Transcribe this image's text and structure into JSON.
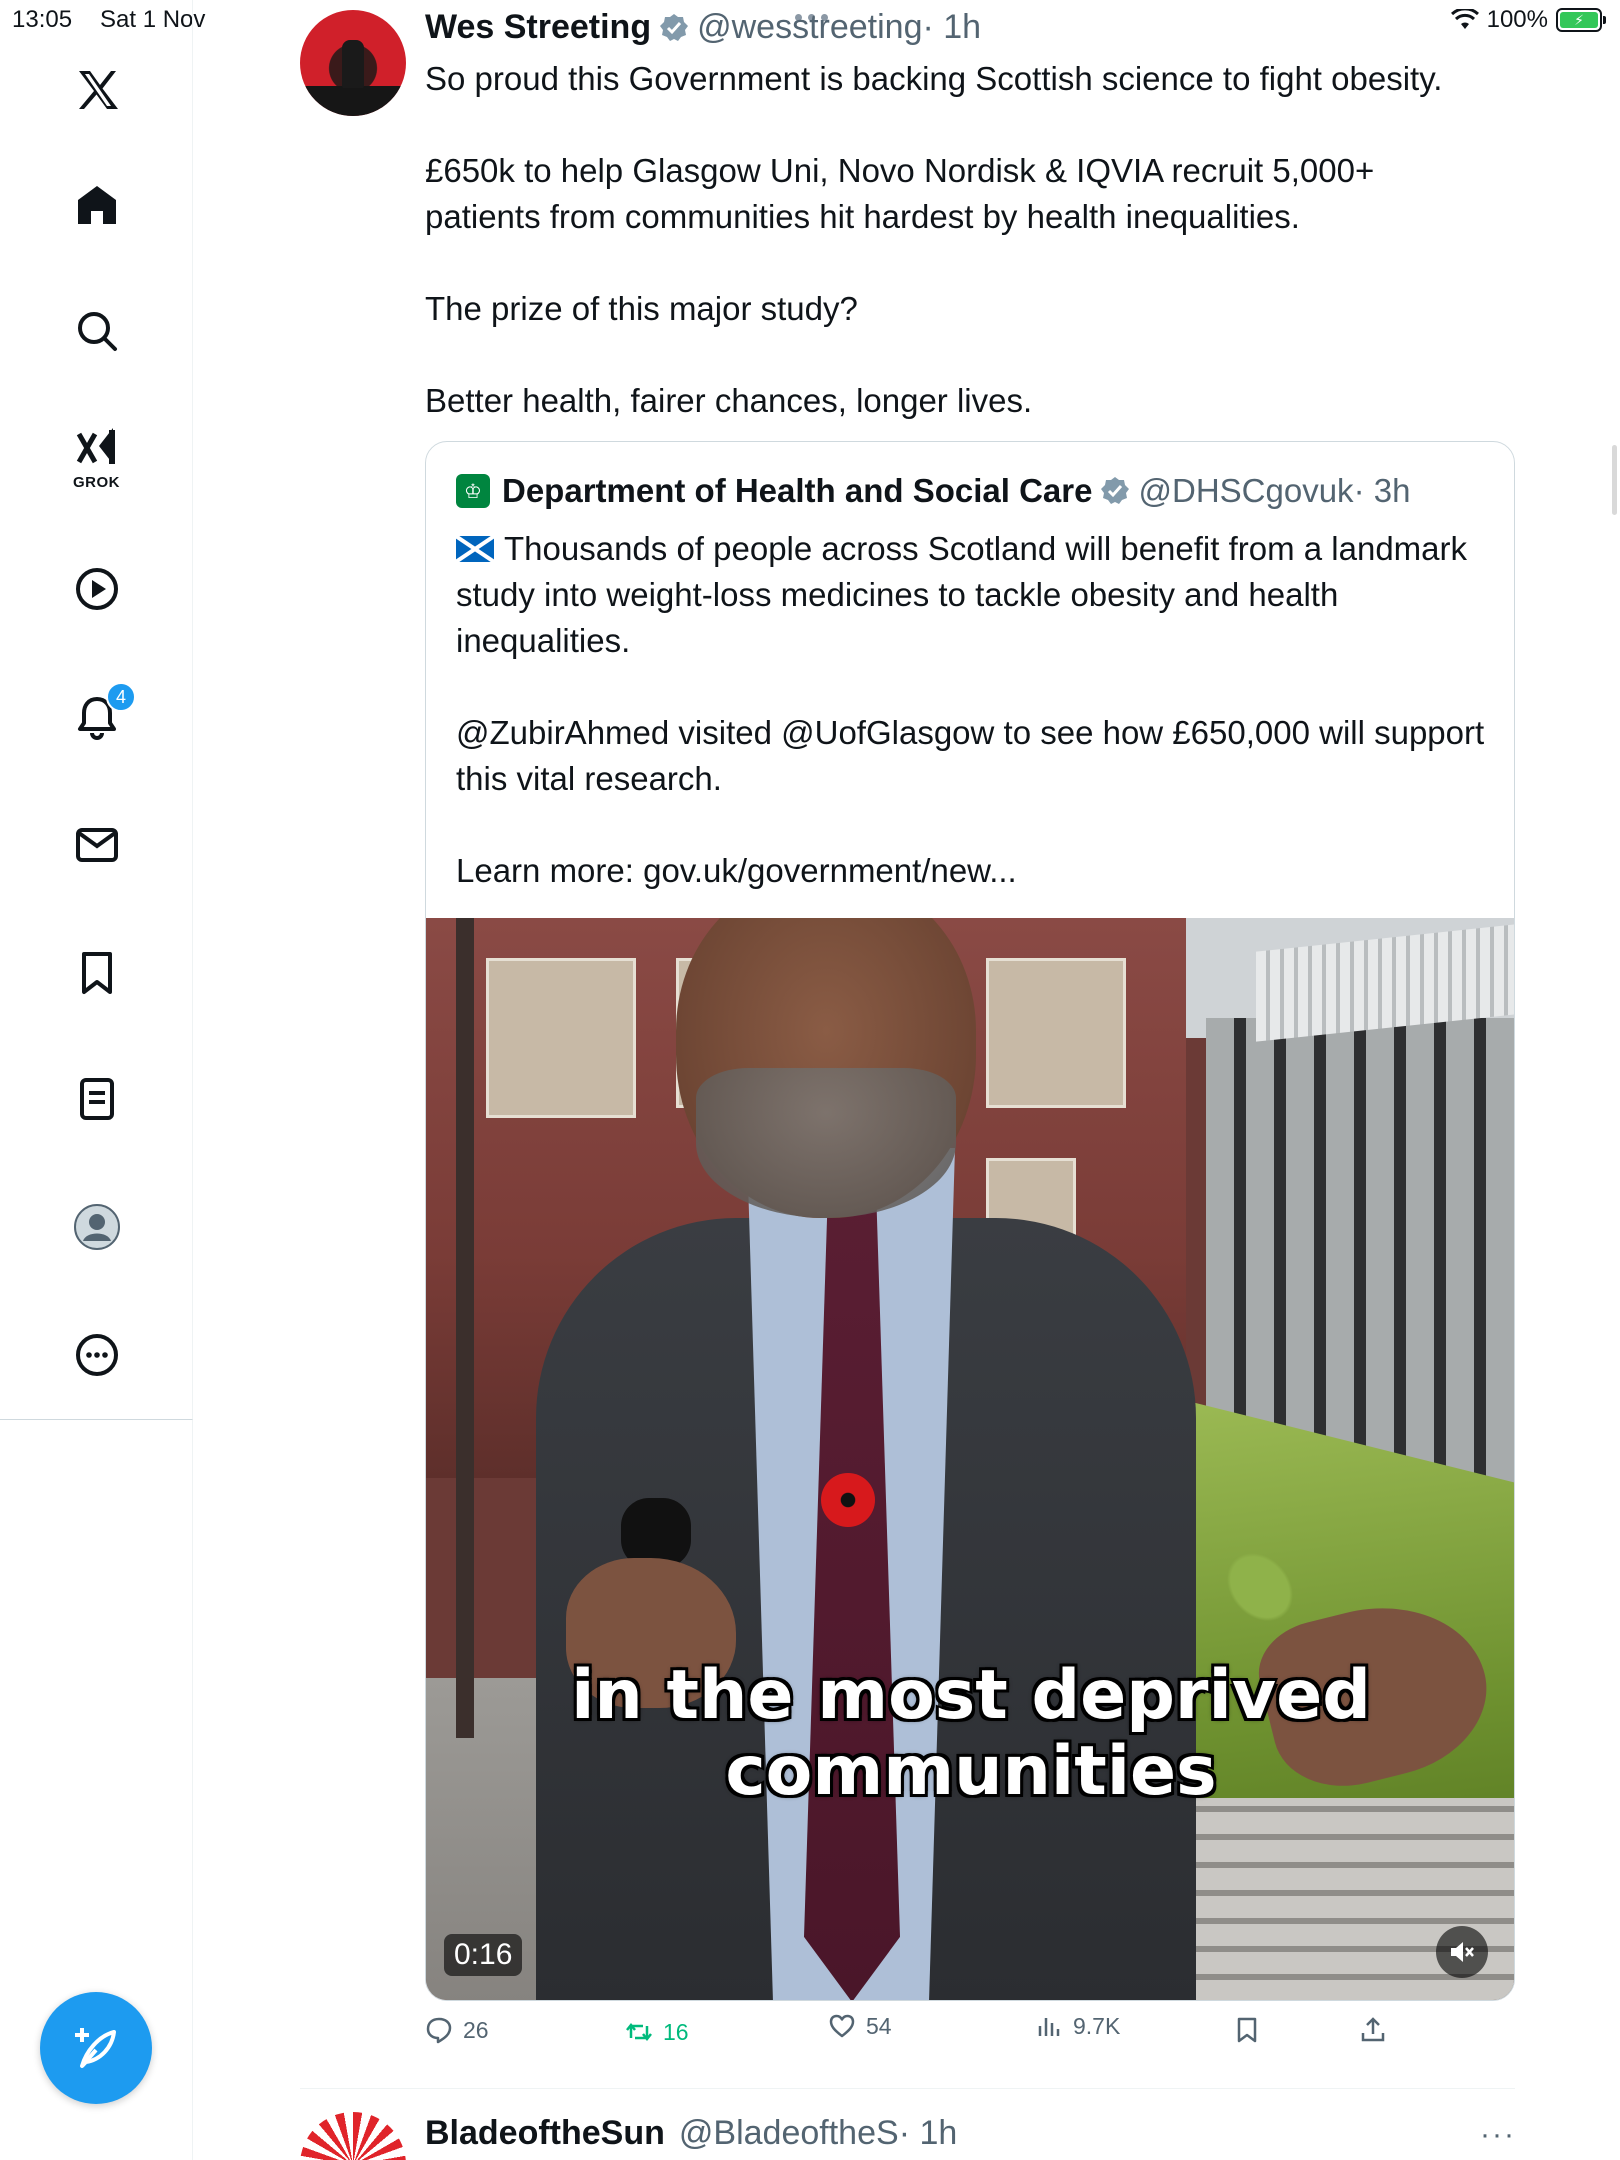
{
  "status_bar": {
    "time": "13:05",
    "date": "Sat 1 Nov",
    "battery": "100%"
  },
  "sidebar": {
    "items": [
      {
        "name": "x-logo",
        "label": ""
      },
      {
        "name": "home",
        "label": ""
      },
      {
        "name": "search",
        "label": ""
      },
      {
        "name": "grok",
        "label": "GROK"
      },
      {
        "name": "video",
        "label": ""
      },
      {
        "name": "notifications",
        "label": "",
        "badge": "4"
      },
      {
        "name": "messages",
        "label": ""
      },
      {
        "name": "bookmarks",
        "label": ""
      },
      {
        "name": "articles",
        "label": ""
      },
      {
        "name": "profile",
        "label": ""
      },
      {
        "name": "more",
        "label": ""
      }
    ],
    "compose_icon": "compose-icon"
  },
  "tweet": {
    "author": "Wes Streeting",
    "handle": "@wesstreeting",
    "time": "· 1h",
    "paragraphs": [
      "So proud this Government is backing Scottish science to fight obesity.",
      "£650k to help Glasgow Uni, Novo Nordisk & IQVIA recruit 5,000+\npatients from communities hit hardest by health inequalities.",
      "The prize of this major study?",
      "Better health, fairer chances, longer lives."
    ],
    "quote": {
      "author": "Department of Health and Social Care",
      "handle": "@DHSCgovuk",
      "time": "· 3h",
      "paragraphs": [
        "Thousands of people across Scotland will benefit from a landmark study into weight-loss medicines to tackle obesity and health inequalities.",
        "@ZubirAhmed visited @UofGlasgow to see how £650,000 will support this vital research.",
        "Learn more: gov.uk/government/new..."
      ],
      "video": {
        "caption_line1": "in the most deprived",
        "caption_line2": "communities",
        "duration": "0:16"
      }
    },
    "actions": {
      "replies": "26",
      "retweets": "16",
      "likes": "54",
      "views": "9.7K"
    }
  },
  "next_tweet": {
    "author": "BladeoftheSun",
    "handle": "@BladeoftheS",
    "time": "· 1h",
    "more": "···"
  },
  "colors": {
    "accent": "#1d9bf0",
    "retweet_green": "#00ba7c",
    "muted_text": "#536471",
    "verified": "#829aab"
  }
}
